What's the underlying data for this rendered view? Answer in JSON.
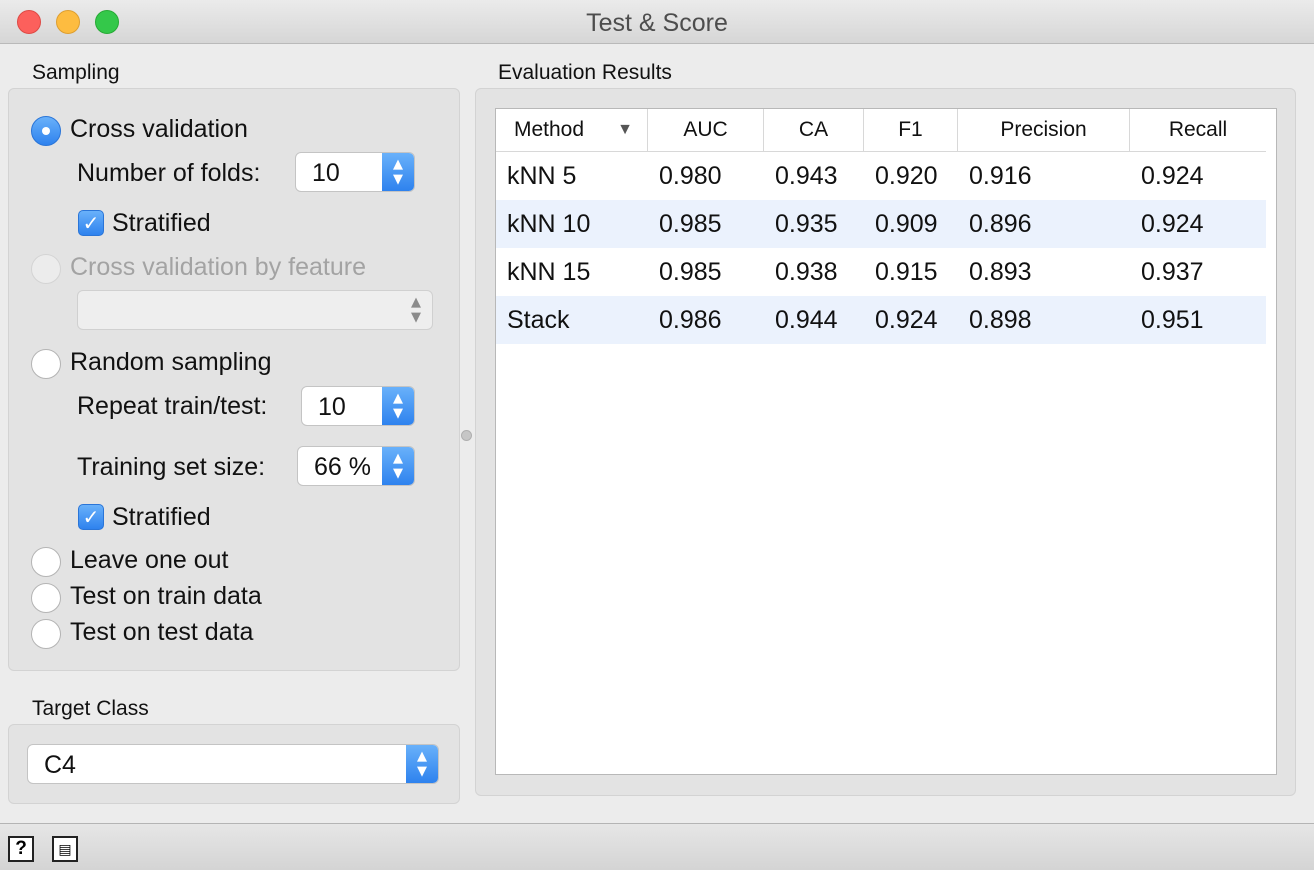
{
  "window": {
    "title": "Test & Score"
  },
  "sampling": {
    "label": "Sampling",
    "cross_validation": "Cross validation",
    "folds_label": "Number of folds:",
    "folds_value": "10",
    "stratified_1": "Stratified",
    "cv_by_feature": "Cross validation by feature",
    "random_sampling": "Random sampling",
    "repeat_label": "Repeat train/test:",
    "repeat_value": "10",
    "train_size_label": "Training set size:",
    "train_size_value": "66 %",
    "stratified_2": "Stratified",
    "leave_one_out": "Leave one out",
    "test_on_train": "Test on train data",
    "test_on_test": "Test on test data"
  },
  "target": {
    "label": "Target Class",
    "value": "C4"
  },
  "results": {
    "label": "Evaluation Results",
    "columns": [
      "Method",
      "AUC",
      "CA",
      "F1",
      "Precision",
      "Recall"
    ],
    "rows": [
      [
        "kNN 5",
        "0.980",
        "0.943",
        "0.920",
        "0.916",
        "0.924"
      ],
      [
        "kNN 10",
        "0.985",
        "0.935",
        "0.909",
        "0.896",
        "0.924"
      ],
      [
        "kNN 15",
        "0.985",
        "0.938",
        "0.915",
        "0.893",
        "0.937"
      ],
      [
        "Stack",
        "0.986",
        "0.944",
        "0.924",
        "0.898",
        "0.951"
      ]
    ]
  },
  "icons": {
    "sort": "sort-down-icon",
    "help": "help-icon",
    "report": "report-icon"
  }
}
